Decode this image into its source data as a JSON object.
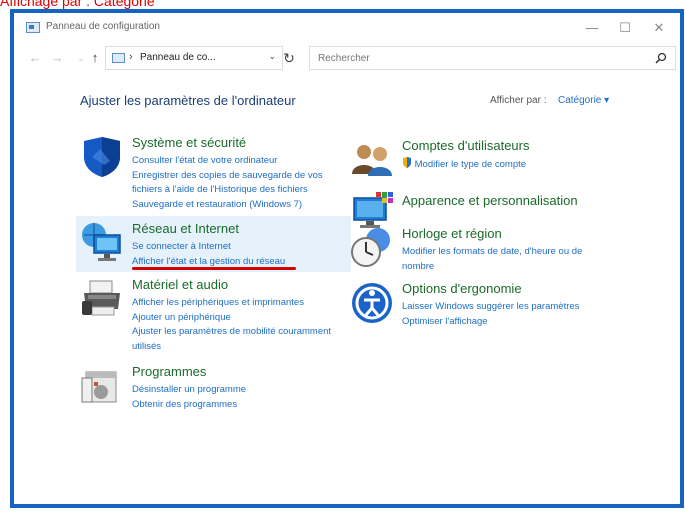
{
  "caption": "Affichage par : Catégorie",
  "window": {
    "title": "Panneau de configuration",
    "controls": {
      "minimize": "—",
      "maximize": "☐",
      "close": "✕"
    }
  },
  "nav": {
    "back": "←",
    "forward": "→",
    "up": "↑",
    "address": "Panneau de co...",
    "address_sep": "›",
    "dropdown": "⌄",
    "refresh": "↻",
    "search_placeholder": "Rechercher"
  },
  "main": {
    "heading": "Ajuster les paramètres de l'ordinateur",
    "view_by_label": "Afficher par :",
    "view_by_value": "Catégorie ▾"
  },
  "categories_left": [
    {
      "title": "Système et sécurité",
      "icon": "shield-icon",
      "links": [
        "Consulter l'état de votre ordinateur",
        "Enregistrer des copies de sauvegarde de vos fichiers à l'aide de l'Historique des fichiers",
        "Sauvegarde et restauration (Windows 7)"
      ]
    },
    {
      "title": "Réseau et Internet",
      "icon": "network-icon",
      "links": [
        "Se connecter à Internet",
        "Afficher l'état et la gestion du réseau"
      ]
    },
    {
      "title": "Matériel et audio",
      "icon": "printer-icon",
      "links": [
        "Afficher les périphériques et imprimantes",
        "Ajouter un périphérique",
        "Ajuster les paramètres de mobilité couramment utilisés"
      ]
    },
    {
      "title": "Programmes",
      "icon": "programs-icon",
      "links": [
        "Désinstaller un programme",
        "Obtenir des programmes"
      ]
    }
  ],
  "categories_right": [
    {
      "title": "Comptes d'utilisateurs",
      "icon": "users-icon",
      "links": [
        "Modifier le type de compte"
      ]
    },
    {
      "title": "Apparence et personnalisation",
      "icon": "monitor-icon",
      "links": []
    },
    {
      "title": "Horloge et région",
      "icon": "clock-icon",
      "links": [
        "Modifier les formats de date, d'heure ou de nombre"
      ]
    },
    {
      "title": "Options d'ergonomie",
      "icon": "accessibility-icon",
      "links": [
        "Laisser Windows suggérer les paramètres",
        "Optimiser l'affichage"
      ]
    }
  ],
  "colors": {
    "accent": "#1e6ec4",
    "category_title": "#1a6b2b",
    "highlight": "#e5f1fb",
    "annotation": "#d40000"
  }
}
